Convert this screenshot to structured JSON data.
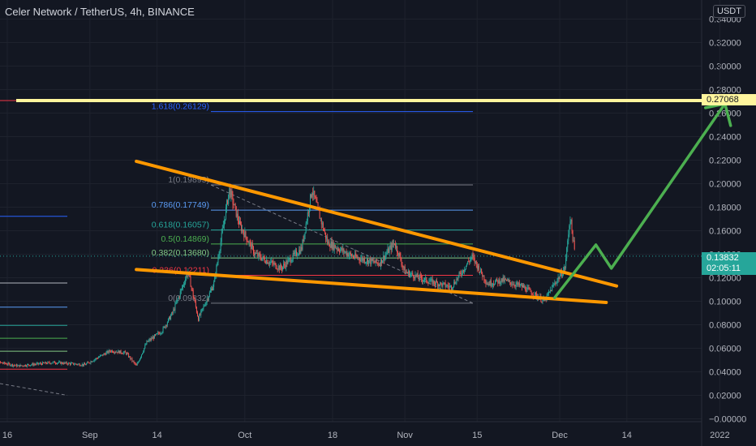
{
  "header": {
    "title": "Celer Network / TetherUS, 4h, BINANCE",
    "currency": "USDT"
  },
  "price_tags": {
    "target": "0.27068",
    "current": "0.13832",
    "countdown": "02:05:11"
  },
  "fib_levels": [
    {
      "label": "1.618(0.26129)",
      "value": 0.26129,
      "color": "#2962ff"
    },
    {
      "label": "1(0.19895)",
      "value": 0.19895,
      "color": "#787b86"
    },
    {
      "label": "0.786(0.17749)",
      "value": 0.17749,
      "color": "#5b9cf6"
    },
    {
      "label": "0.618(0.16057)",
      "value": 0.16057,
      "color": "#26a69a"
    },
    {
      "label": "0.5(0.14869)",
      "value": 0.14869,
      "color": "#4caf50"
    },
    {
      "label": "0.382(0.13680)",
      "value": 0.1368,
      "color": "#81c784"
    },
    {
      "label": "0.236(0.12211)",
      "value": 0.12211,
      "color": "#f23645"
    },
    {
      "label": "0(0.09832)",
      "value": 0.09832,
      "color": "#787b86"
    }
  ],
  "colors": {
    "background": "#131722",
    "up": "#26a69a",
    "down": "#ef5350",
    "trendline": "#ff9800",
    "target_line": "#fff59d",
    "projection": "#4caf50",
    "grid": "#1e222d"
  },
  "chart_data": {
    "type": "candlestick",
    "title": "Celer Network / TetherUS, 4h, BINANCE",
    "ylabel": "USDT",
    "ylim": [
      -0.005,
      0.345
    ],
    "y_ticks": [
      "−0.00000",
      "0.02000",
      "0.04000",
      "0.06000",
      "0.08000",
      "0.10000",
      "0.12000",
      "0.14000",
      "0.16000",
      "0.18000",
      "0.20000",
      "0.22000",
      "0.24000",
      "0.26000",
      "0.28000",
      "0.30000",
      "0.32000",
      "0.34000"
    ],
    "y_tick_values": [
      0,
      0.02,
      0.04,
      0.06,
      0.08,
      0.1,
      0.12,
      0.14,
      0.16,
      0.18,
      0.2,
      0.22,
      0.24,
      0.26,
      0.28,
      0.3,
      0.32,
      0.34
    ],
    "x_ticks": [
      "16",
      "Sep",
      "14",
      "Oct",
      "18",
      "Nov",
      "15",
      "Dec",
      "14",
      "2022"
    ],
    "x_tick_dates": [
      "2021-08-16",
      "2021-09-01",
      "2021-09-14",
      "2021-10-01",
      "2021-10-18",
      "2021-11-01",
      "2021-11-15",
      "2021-12-01",
      "2021-12-14",
      "2022-01-01"
    ],
    "price_path": [
      [
        "2021-08-12",
        0.05
      ],
      [
        "2021-08-18",
        0.045
      ],
      [
        "2021-08-25",
        0.048
      ],
      [
        "2021-08-31",
        0.046
      ],
      [
        "2021-09-05",
        0.058
      ],
      [
        "2021-09-08",
        0.056
      ],
      [
        "2021-09-10",
        0.045
      ],
      [
        "2021-09-12",
        0.065
      ],
      [
        "2021-09-15",
        0.075
      ],
      [
        "2021-09-17",
        0.09
      ],
      [
        "2021-09-20",
        0.125
      ],
      [
        "2021-09-22",
        0.085
      ],
      [
        "2021-09-25",
        0.115
      ],
      [
        "2021-09-28",
        0.195
      ],
      [
        "2021-09-30",
        0.165
      ],
      [
        "2021-10-03",
        0.14
      ],
      [
        "2021-10-08",
        0.128
      ],
      [
        "2021-10-12",
        0.145
      ],
      [
        "2021-10-14",
        0.195
      ],
      [
        "2021-10-17",
        0.15
      ],
      [
        "2021-10-22",
        0.138
      ],
      [
        "2021-10-27",
        0.132
      ],
      [
        "2021-10-30",
        0.15
      ],
      [
        "2021-11-01",
        0.125
      ],
      [
        "2021-11-05",
        0.118
      ],
      [
        "2021-11-10",
        0.112
      ],
      [
        "2021-11-14",
        0.138
      ],
      [
        "2021-11-17",
        0.115
      ],
      [
        "2021-11-20",
        0.118
      ],
      [
        "2021-11-24",
        0.112
      ],
      [
        "2021-11-28",
        0.1
      ],
      [
        "2021-11-30",
        0.115
      ],
      [
        "2021-12-02",
        0.128
      ],
      [
        "2021-12-03",
        0.172
      ],
      [
        "2021-12-04",
        0.138
      ]
    ],
    "current_price": 0.13832,
    "target_price": 0.27068,
    "annotations": {
      "upper_trendline": [
        [
          "2021-09-10",
          0.219
        ],
        [
          "2021-12-12",
          0.113
        ]
      ],
      "lower_trendline": [
        [
          "2021-09-10",
          0.127
        ],
        [
          "2021-12-10",
          0.099
        ]
      ],
      "projection_path": [
        [
          "2021-11-30",
          0.103
        ],
        [
          "2021-12-08",
          0.148
        ],
        [
          "2021-12-11",
          0.128
        ],
        [
          "2022-01-02",
          0.268
        ]
      ],
      "target_line_value": 0.27068
    }
  }
}
